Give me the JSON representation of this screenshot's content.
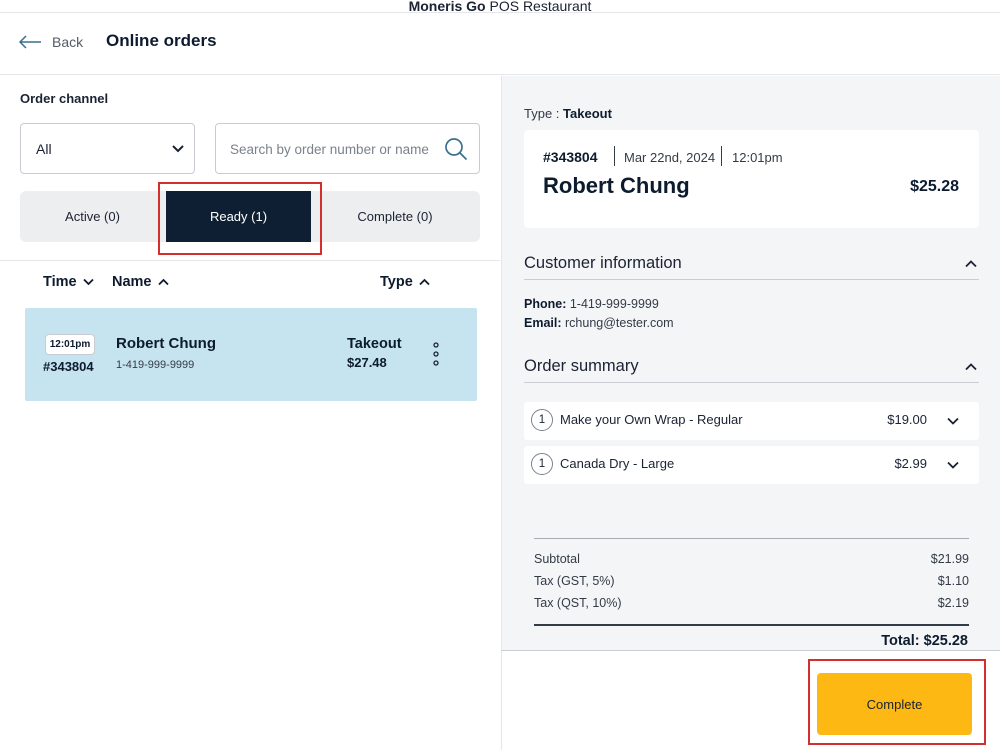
{
  "app": {
    "brand": "Moneris Go",
    "product": "POS Restaurant"
  },
  "header": {
    "back_label": "Back",
    "title": "Online orders"
  },
  "filters": {
    "channel_label": "Order channel",
    "channel_value": "All",
    "search_placeholder": "Search by order number or name"
  },
  "tabs": [
    {
      "label": "Active (0)",
      "selected": false
    },
    {
      "label": "Ready (1)",
      "selected": true
    },
    {
      "label": "Complete (0)",
      "selected": false
    }
  ],
  "columns": {
    "time": "Time",
    "name": "Name",
    "type": "Type"
  },
  "orders": [
    {
      "time": "12:01pm",
      "number": "#343804",
      "name": "Robert Chung",
      "phone": "1-419-999-9999",
      "type": "Takeout",
      "amount": "$27.48"
    }
  ],
  "detail": {
    "type_label": "Type :",
    "type_value": "Takeout",
    "order_number": "#343804",
    "date": "Mar 22nd, 2024",
    "time": "12:01pm",
    "customer_name": "Robert Chung",
    "total": "$25.28",
    "customer_section": "Customer information",
    "phone_label": "Phone:",
    "phone": "1-419-999-9999",
    "email_label": "Email:",
    "email": "rchung@tester.com",
    "order_section": "Order summary",
    "items": [
      {
        "qty": "1",
        "name": "Make your Own Wrap - Regular",
        "price": "$19.00"
      },
      {
        "qty": "1",
        "name": "Canada Dry - Large",
        "price": "$2.99"
      }
    ],
    "subtotal_label": "Subtotal",
    "subtotal": "$21.99",
    "gst_label": "Tax (GST, 5%)",
    "gst": "$1.10",
    "qst_label": "Tax (QST, 10%)",
    "qst": "$2.19",
    "grand_total": "Total: $25.28"
  },
  "actions": {
    "complete_label": "Complete"
  },
  "colors": {
    "accent": "#fdb813",
    "selected_tab": "#0f1f33",
    "selected_row": "#c6e4f0",
    "highlight": "#d32f2f"
  }
}
